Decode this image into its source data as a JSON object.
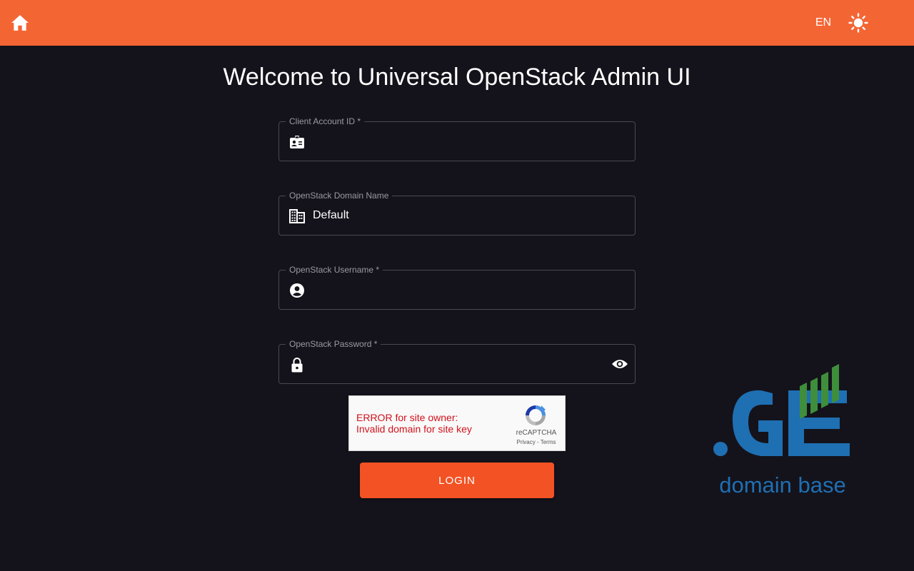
{
  "header": {
    "language": "EN",
    "icons": {
      "home": "home-icon",
      "theme": "sun-icon"
    },
    "accent_color": "#f46534"
  },
  "page": {
    "title": "Welcome to Universal OpenStack Admin UI"
  },
  "form": {
    "client_account_id": {
      "label": "Client Account ID *",
      "value": "",
      "icon": "badge-icon"
    },
    "domain_name": {
      "label": "OpenStack Domain Name",
      "value": "Default",
      "icon": "building-icon"
    },
    "username": {
      "label": "OpenStack Username *",
      "value": "",
      "icon": "account-circle-icon"
    },
    "password": {
      "label": "OpenStack Password *",
      "value": "",
      "icon": "lock-icon",
      "toggle_icon": "eye-icon"
    }
  },
  "recaptcha": {
    "error_line1": "ERROR for site owner:",
    "error_line2": "Invalid domain for site key",
    "brand": "reCAPTCHA",
    "privacy": "Privacy",
    "separator": "-",
    "terms": "Terms"
  },
  "login": {
    "label": "LOGIN",
    "color": "#f25224"
  },
  "logo": {
    "text": "domain base",
    "mark": ".GE",
    "colors": {
      "blue": "#1f6fb3",
      "green": "#3e8e3b"
    }
  }
}
